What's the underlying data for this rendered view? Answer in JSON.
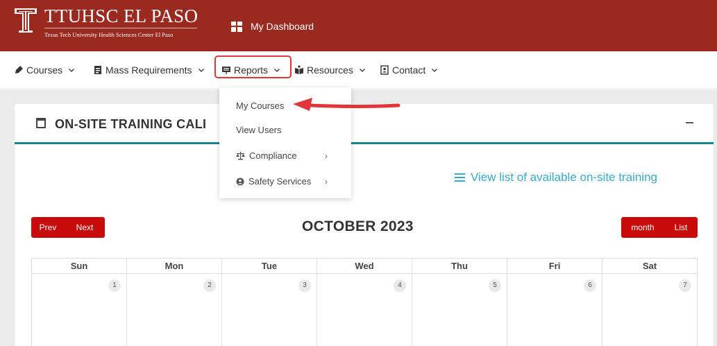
{
  "header": {
    "logo_title": "TTUHSC EL PASO",
    "logo_subtitle": "Texas Tech University Health Sciences Center El Paso",
    "dashboard_label": "My Dashboard"
  },
  "nav": {
    "courses": "Courses",
    "mass_requirements": "Mass Requirements",
    "reports": "Reports",
    "resources": "Resources",
    "contact": "Contact"
  },
  "dropdown": {
    "items": [
      "My Courses",
      "View Users",
      "Compliance",
      "Safety Services"
    ]
  },
  "card": {
    "title": "ON-SITE TRAINING CALI",
    "view_list": "View list of available on-site training"
  },
  "calendar": {
    "prev": "Prev",
    "next": "Next",
    "month_title": "OCTOBER 2023",
    "view_month": "month",
    "view_list": "List",
    "weekdays": [
      "Sun",
      "Mon",
      "Tue",
      "Wed",
      "Thu",
      "Fri",
      "Sat"
    ],
    "days": [
      "1",
      "2",
      "3",
      "4",
      "5",
      "6",
      "7"
    ]
  },
  "colors": {
    "brand_red": "#9a2a20",
    "button_red": "#c90a0a",
    "teal": "#15868a",
    "link_blue": "#39aac5",
    "highlight_red": "#e0353a"
  }
}
